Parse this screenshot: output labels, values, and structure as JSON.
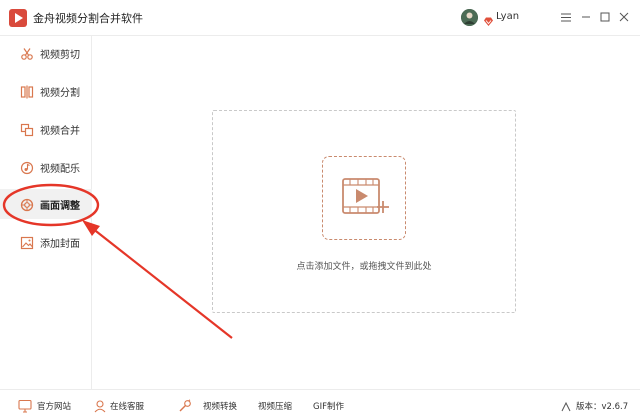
{
  "app": {
    "title": "金舟视频分割合并软件",
    "user_name": "Lyan"
  },
  "window_controls": [
    "minimize",
    "restore",
    "close"
  ],
  "sidebar": {
    "items": [
      {
        "label": "视频剪切",
        "icon": "scissors-icon",
        "active": false
      },
      {
        "label": "视频分割",
        "icon": "split-icon",
        "active": false
      },
      {
        "label": "视频合并",
        "icon": "merge-icon",
        "active": false
      },
      {
        "label": "视频配乐",
        "icon": "music-icon",
        "active": false
      },
      {
        "label": "画面调整",
        "icon": "adjust-icon",
        "active": true
      },
      {
        "label": "添加封面",
        "icon": "image-icon",
        "active": false
      }
    ]
  },
  "main": {
    "drop_hint": "点击添加文件，或拖拽文件到此处"
  },
  "bottombar": {
    "items": [
      {
        "label": "官方网站",
        "icon": "monitor-icon"
      },
      {
        "label": "在线客服",
        "icon": "headset-user-icon"
      },
      {
        "label": "视频转换",
        "icon": "tool-icon"
      },
      {
        "label": "视频压缩",
        "icon": ""
      },
      {
        "label": "GIF制作",
        "icon": ""
      }
    ],
    "version": "版本：v2.6.7"
  },
  "colors": {
    "brand": "#d94a3c",
    "accent": "#c98a6e",
    "annotation": "#e53628"
  }
}
